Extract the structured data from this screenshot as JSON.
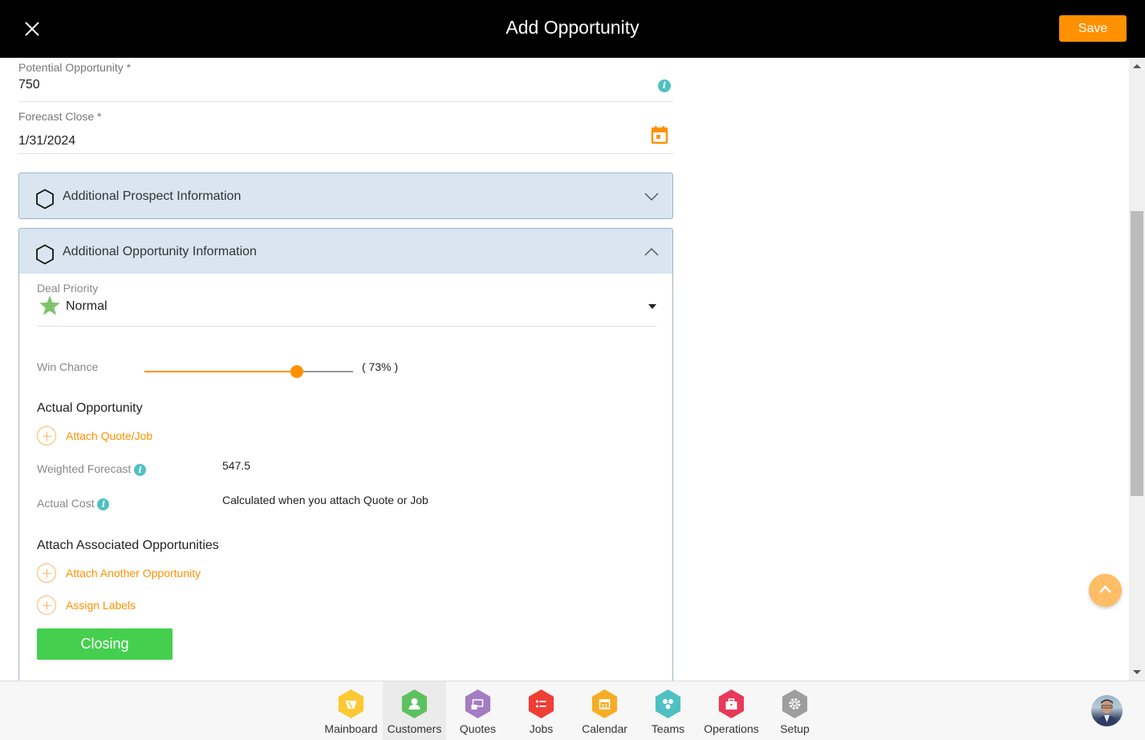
{
  "header": {
    "title": "Add Opportunity",
    "save_label": "Save"
  },
  "fields": {
    "potential_opportunity": {
      "label": "Potential Opportunity *",
      "value": "750"
    },
    "forecast_close": {
      "label": "Forecast Close *",
      "value": "1/31/2024"
    }
  },
  "accordions": [
    {
      "title": "Additional Prospect Information",
      "expanded": false
    },
    {
      "title": "Additional Opportunity Information",
      "expanded": true
    }
  ],
  "opportunity_info": {
    "deal_priority": {
      "label": "Deal Priority",
      "value": "Normal"
    },
    "win_chance": {
      "label": "Win Chance",
      "percent": 73,
      "display": "( 73% )"
    },
    "actual_opportunity": {
      "heading": "Actual Opportunity",
      "attach_link": "Attach Quote/Job",
      "weighted_forecast": {
        "label": "Weighted Forecast",
        "value": "547.5"
      },
      "actual_cost": {
        "label": "Actual Cost",
        "value": "Calculated when you attach Quote or Job"
      }
    },
    "associated": {
      "heading": "Attach Associated Opportunities",
      "attach_link": "Attach Another Opportunity",
      "labels_link": "Assign Labels"
    },
    "closing_label": "Closing"
  },
  "colors": {
    "accent": "#ff9100",
    "closing": "#45cf4e",
    "info": "#4fc1c3",
    "star": "#7fc36e"
  },
  "bottom_nav": [
    {
      "label": "Mainboard",
      "color": "#fdc832",
      "icon": "mainboard-icon",
      "active": false
    },
    {
      "label": "Customers",
      "color": "#5ec15f",
      "icon": "customer-icon",
      "active": true
    },
    {
      "label": "Quotes",
      "color": "#a57bc4",
      "icon": "quotes-icon",
      "active": false
    },
    {
      "label": "Jobs",
      "color": "#ef3e36",
      "icon": "jobs-icon",
      "active": false
    },
    {
      "label": "Calendar",
      "color": "#f7ac24",
      "icon": "calendar-icon",
      "active": false
    },
    {
      "label": "Teams",
      "color": "#4fc1c3",
      "icon": "teams-icon",
      "active": false
    },
    {
      "label": "Operations",
      "color": "#e8395a",
      "icon": "operations-icon",
      "active": false
    },
    {
      "label": "Setup",
      "color": "#9e9e9e",
      "icon": "setup-icon",
      "active": false
    }
  ]
}
